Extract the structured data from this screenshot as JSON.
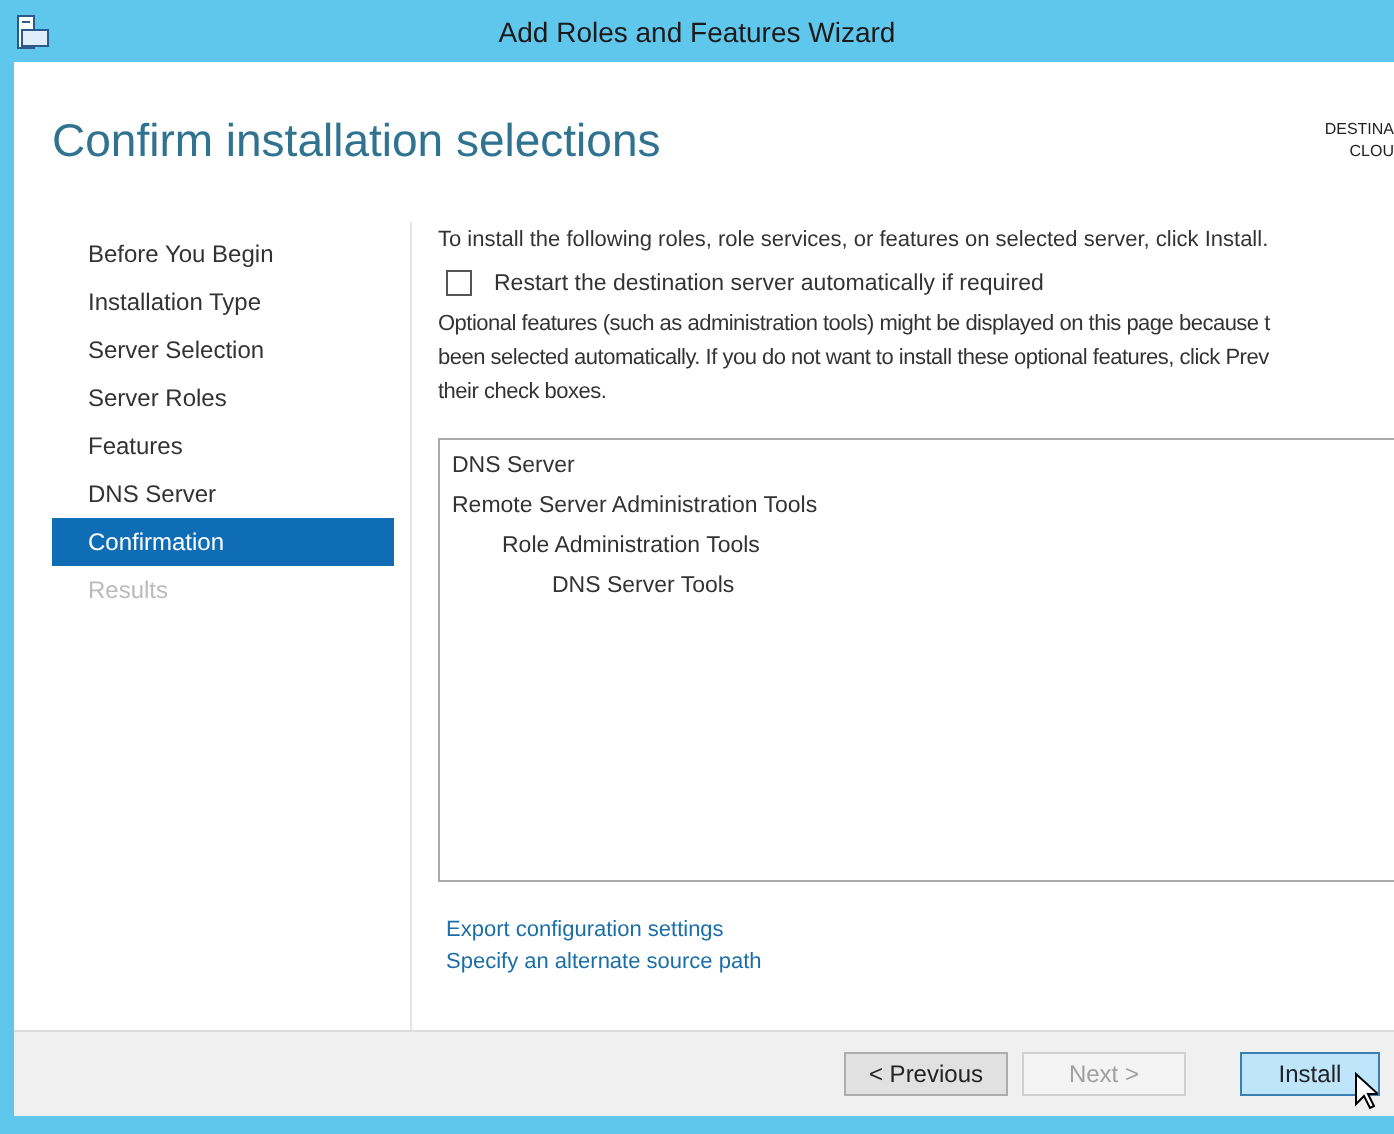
{
  "window": {
    "title": "Add Roles and Features Wizard"
  },
  "header": {
    "title": "Confirm installation selections",
    "destination_lines": [
      "DESTINA",
      "CLOU"
    ]
  },
  "sidebar": {
    "items": [
      {
        "label": "Before You Begin",
        "selected": false,
        "disabled": false
      },
      {
        "label": "Installation Type",
        "selected": false,
        "disabled": false
      },
      {
        "label": "Server Selection",
        "selected": false,
        "disabled": false
      },
      {
        "label": "Server Roles",
        "selected": false,
        "disabled": false
      },
      {
        "label": "Features",
        "selected": false,
        "disabled": false
      },
      {
        "label": "DNS Server",
        "selected": false,
        "disabled": false
      },
      {
        "label": "Confirmation",
        "selected": true,
        "disabled": false
      },
      {
        "label": "Results",
        "selected": false,
        "disabled": true
      }
    ]
  },
  "content": {
    "intro": "To install the following roles, role services, or features on selected server, click Install.",
    "restart_checkbox": {
      "label": "Restart the destination server automatically if required",
      "checked": false
    },
    "note_lines": [
      "Optional features (such as administration tools) might be displayed on this page because t",
      "been selected automatically. If you do not want to install these optional features, click Prev",
      "their check boxes."
    ],
    "selection_list": [
      {
        "label": "DNS Server"
      },
      {
        "label": "Remote Server Administration Tools",
        "children": [
          {
            "label": "Role Administration Tools",
            "children": [
              {
                "label": "DNS Server Tools"
              }
            ]
          }
        ]
      }
    ],
    "links": [
      "Export configuration settings",
      "Specify an alternate source path"
    ]
  },
  "buttons": [
    {
      "label": "< Previous",
      "disabled": false,
      "hovered": false
    },
    {
      "label": "Next >",
      "disabled": true,
      "hovered": false
    },
    {
      "label": "Install",
      "disabled": false,
      "hovered": true
    }
  ]
}
